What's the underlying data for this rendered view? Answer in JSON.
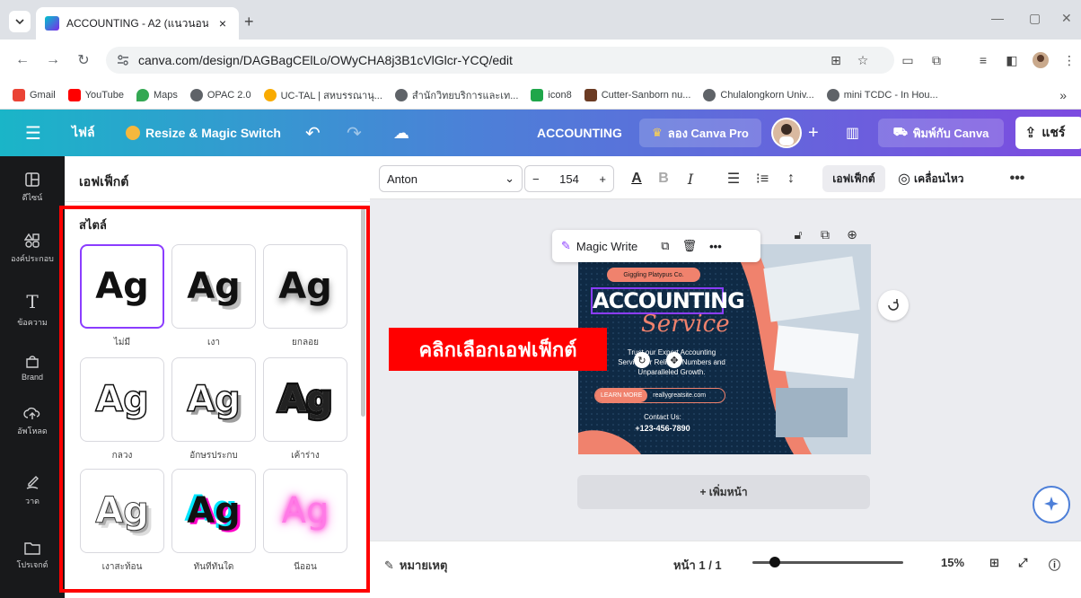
{
  "browser": {
    "tab_title": "ACCOUNTING - A2 (แนวนอน)",
    "url": "canva.com/design/DAGBagCElLo/OWyCHA8j3B1cVlGlcr-YCQ/edit",
    "bookmarks": [
      {
        "label": "Gmail",
        "color": "#ea4335"
      },
      {
        "label": "YouTube",
        "color": "#ff0000"
      },
      {
        "label": "Maps",
        "color": "#34a853"
      },
      {
        "label": "OPAC 2.0",
        "color": "#5f6368"
      },
      {
        "label": "UC-TAL | สหบรรณานุ...",
        "color": "#f9ab00"
      },
      {
        "label": "สำนักวิทยบริการและเท...",
        "color": "#5f6368"
      },
      {
        "label": "icon8",
        "color": "#1fa64a"
      },
      {
        "label": "Cutter-Sanborn nu...",
        "color": "#6b3b23"
      },
      {
        "label": "Chulalongkorn Univ...",
        "color": "#5f6368"
      },
      {
        "label": "mini TCDC - In Hou...",
        "color": "#5f6368"
      }
    ]
  },
  "toolbar": {
    "file": "ไฟล์",
    "resize": "Resize & Magic Switch",
    "doc_title": "ACCOUNTING",
    "try_pro": "ลอง Canva Pro",
    "print": "พิมพ์กับ Canva",
    "share": "แชร์"
  },
  "rail": [
    {
      "label": "ดีไซน์",
      "icon": "layout-icon"
    },
    {
      "label": "องค์ประกอบ",
      "icon": "elements-icon"
    },
    {
      "label": "ข้อความ",
      "icon": "text-icon"
    },
    {
      "label": "Brand",
      "icon": "brand-icon"
    },
    {
      "label": "อัพโหลด",
      "icon": "upload-icon"
    },
    {
      "label": "วาด",
      "icon": "draw-icon"
    },
    {
      "label": "โปรเจกต์",
      "icon": "folder-icon"
    }
  ],
  "panel": {
    "title": "เอฟเฟ็กต์",
    "section": "สไตล์",
    "styles": [
      {
        "label": "ไม่มี"
      },
      {
        "label": "เงา"
      },
      {
        "label": "ยกลอย"
      },
      {
        "label": "กลวง"
      },
      {
        "label": "อักษรประกบ"
      },
      {
        "label": "เค้าร่าง"
      },
      {
        "label": "เงาสะท้อน"
      },
      {
        "label": "ทันทีทันใด"
      },
      {
        "label": "นีออน"
      }
    ],
    "tile_text": "Ag"
  },
  "ctx": {
    "font": "Anton",
    "size": "154",
    "effects": "เอฟเฟ็กต์",
    "animate": "เคลื่อนไหว"
  },
  "canvas": {
    "magic_write": "Magic Write",
    "brand": "Giggling Platypus Co.",
    "headline": "ACCOUNTING",
    "script": "Service",
    "body1": "Trust our Expert Accounting",
    "body2": "Service for Reliable Numbers and",
    "body3": "Unparalleled Growth.",
    "learn": "LEARN MORE",
    "site": "reallygreatsite.com",
    "contact": "Contact Us:",
    "phone": "+123-456-7890",
    "add_page": "+ เพิ่มหน้า",
    "callout": "คลิกเลือกเอฟเฟ็กต์"
  },
  "footer": {
    "notes": "หมายเหตุ",
    "page": "หน้า 1 / 1",
    "zoom": "15%",
    "zoom_level": 0.15
  },
  "colors": {
    "highlight": "#ff0000",
    "selected_tile": "#8b3dff",
    "accent_salmon": "#f0826d"
  }
}
